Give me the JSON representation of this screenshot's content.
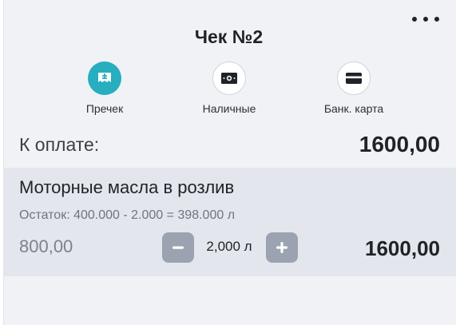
{
  "header": {
    "title": "Чек №2",
    "more_icon": "more-horizontal-icon"
  },
  "payment_methods": [
    {
      "label": "Пречек",
      "icon": "receipt-icon",
      "active": true
    },
    {
      "label": "Наличные",
      "icon": "cash-icon",
      "active": false
    },
    {
      "label": "Банк. карта",
      "icon": "credit-card-icon",
      "active": false
    }
  ],
  "total": {
    "label": "К оплате:",
    "value": "1600,00"
  },
  "items": [
    {
      "name": "Моторные масла в розлив",
      "remainder": "Остаток: 400.000 - 2.000 = 398.000 л",
      "price": "800,00",
      "quantity": "2,000 л",
      "sum": "1600,00"
    }
  ],
  "colors": {
    "accent": "#27aebf",
    "panel_background": "#f1f2f6",
    "item_background": "#e3e6ec",
    "stepper_button": "#9ba3b0"
  }
}
